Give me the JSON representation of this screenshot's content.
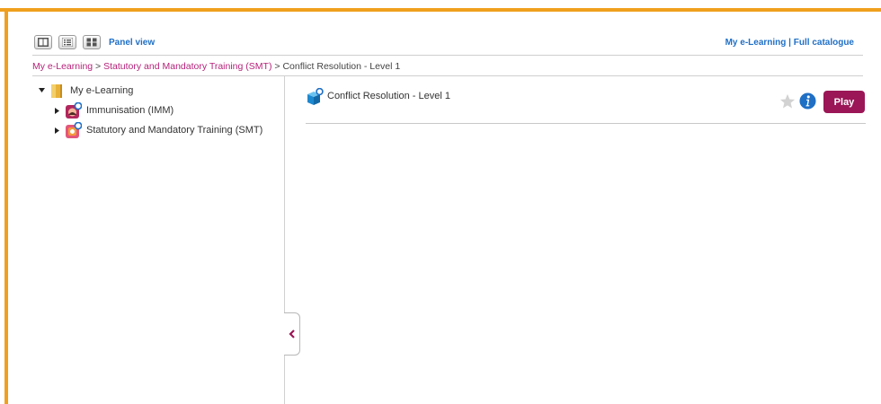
{
  "toolbar": {
    "views": [
      {
        "icon": "columns-view-icon"
      },
      {
        "icon": "list-view-icon"
      },
      {
        "icon": "grid-view-icon"
      }
    ],
    "panel_view_label": "Panel view",
    "link_my_elearning": "My e-Learning",
    "link_separator": "|",
    "link_full_catalogue": "Full catalogue"
  },
  "breadcrumb": {
    "items": [
      "My e-Learning",
      "Statutory and Mandatory Training (SMT)"
    ],
    "separator": ">",
    "current": "Conflict Resolution - Level 1"
  },
  "tree": {
    "root": {
      "label": "My e-Learning",
      "icon": "folder-icon",
      "expanded": true
    },
    "children": [
      {
        "label": "Immunisation (IMM)",
        "icon": "course-group-icon",
        "expanded": false
      },
      {
        "label": "Statutory and Mandatory Training (SMT)",
        "icon": "course-group-icon",
        "expanded": false
      }
    ]
  },
  "content": {
    "items": [
      {
        "title": "Conflict Resolution - Level 1",
        "icon": "module-cube-icon",
        "play_label": "Play"
      }
    ]
  },
  "colors": {
    "frame": "#f0a01e",
    "link_blue": "#1f6fc5",
    "breadcrumb_link": "#b5227a",
    "play_button": "#9b1656",
    "info_icon": "#1f6fc5"
  }
}
